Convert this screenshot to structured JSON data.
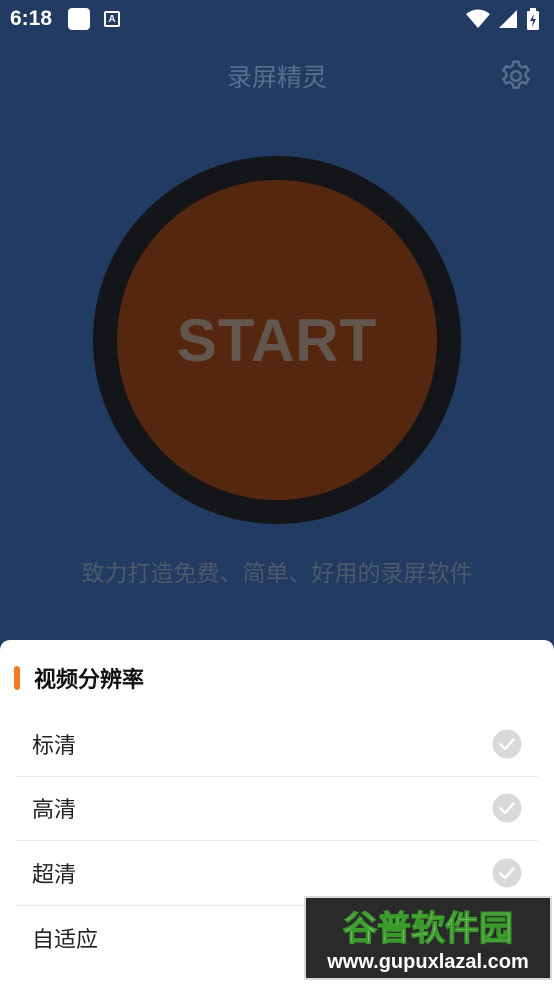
{
  "status_bar": {
    "time": "6:18",
    "notification_icon_letter": "A"
  },
  "header": {
    "title": "录屏精灵",
    "settings_icon": "gear-icon"
  },
  "main": {
    "start_label": "START",
    "slogan": "致力打造免费、简单、好用的录屏软件"
  },
  "sheet": {
    "title": "视频分辨率",
    "options": [
      {
        "label": "标清"
      },
      {
        "label": "高清"
      },
      {
        "label": "超清"
      },
      {
        "label": "自适应"
      }
    ]
  },
  "watermark": {
    "brand": "谷普软件园",
    "url": "www.gupuxlazal.com"
  },
  "colors": {
    "background": "#213b62",
    "start_ring": "#141518",
    "start_fill": "#55270f",
    "accent": "#f47920",
    "check_gray": "#d9d9d9"
  }
}
